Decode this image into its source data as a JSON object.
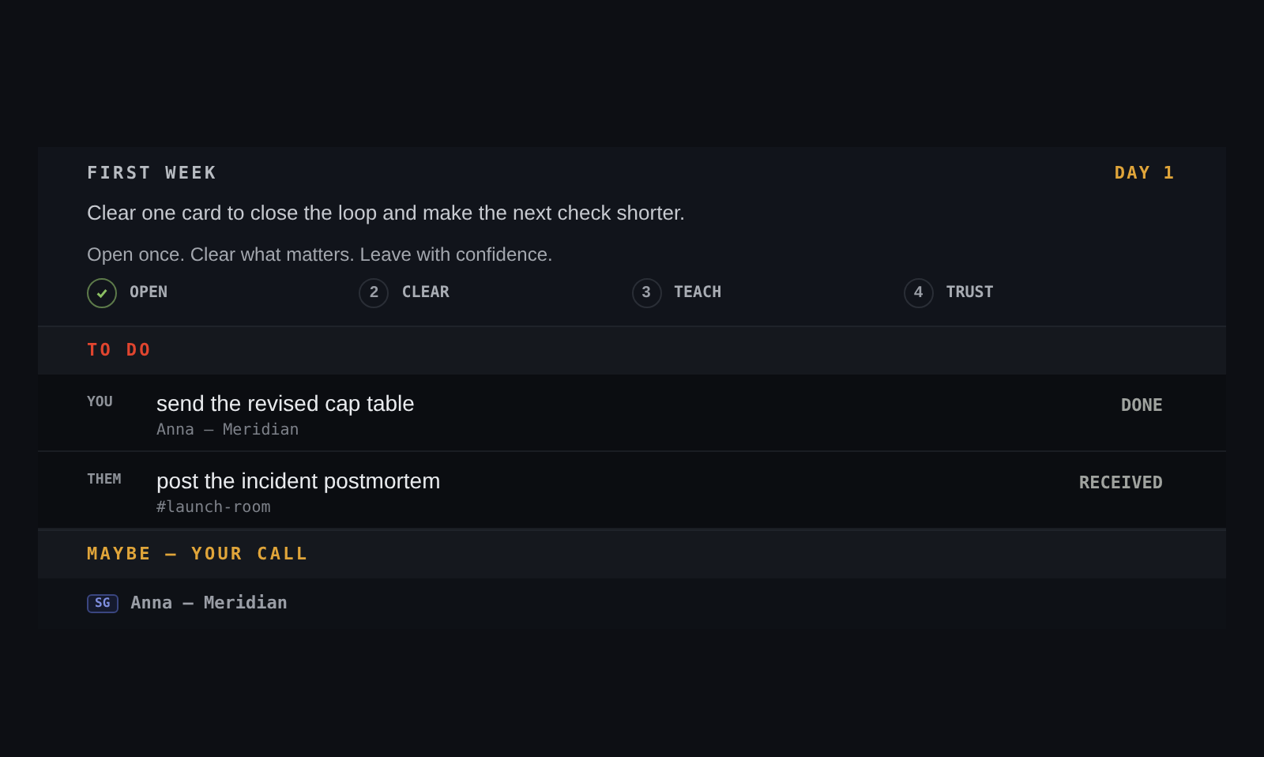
{
  "header": {
    "eyebrow": "FIRST WEEK",
    "day": "DAY 1",
    "headline": "Clear one card to close the loop and make the next check shorter.",
    "subline": "Open once. Clear what matters. Leave with confidence.",
    "steps": [
      {
        "label": "OPEN",
        "done": true
      },
      {
        "number": "2",
        "label": "CLEAR",
        "done": false
      },
      {
        "number": "3",
        "label": "TEACH",
        "done": false
      },
      {
        "number": "4",
        "label": "TRUST",
        "done": false
      }
    ]
  },
  "sections": [
    {
      "title": "TO DO",
      "kind": "todo",
      "items": [
        {
          "owner": "YOU",
          "title": "send the revised cap table",
          "source": "Anna — Meridian",
          "status": "DONE"
        },
        {
          "owner": "THEM",
          "title": "post the incident postmortem",
          "source": "#launch-room",
          "status": "RECEIVED"
        }
      ]
    },
    {
      "title": "MAYBE — YOUR CALL",
      "kind": "maybe",
      "items": [
        {
          "tag": "SG",
          "source": "Anna — Meridian"
        }
      ]
    }
  ]
}
